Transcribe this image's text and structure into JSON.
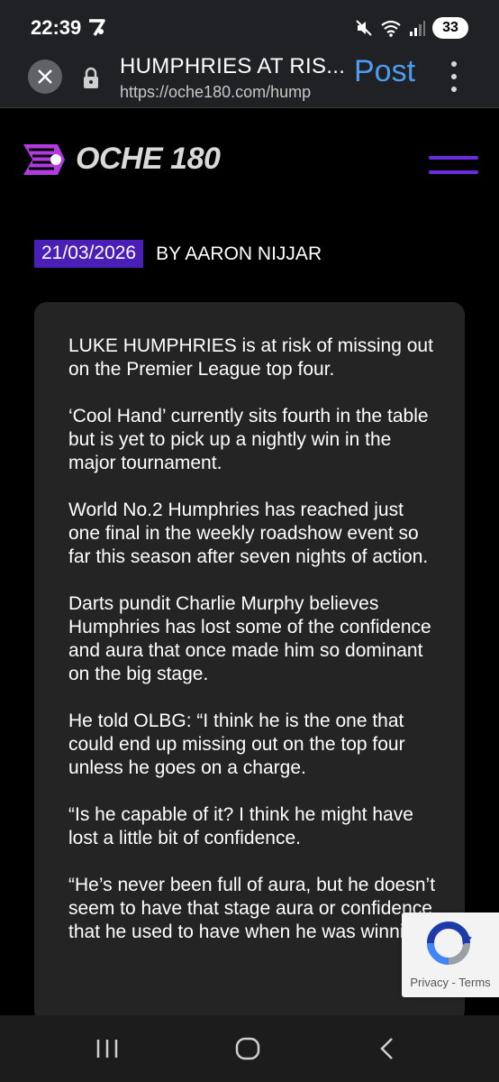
{
  "status": {
    "time": "22:39",
    "battery": "33"
  },
  "browser": {
    "page_title": "HUMPHRIES AT RIS...",
    "url": "https://oche180.com/hump",
    "post_label": "Post"
  },
  "site": {
    "logo_text": "OCHE 180",
    "accent_color": "#6b2ce0"
  },
  "article": {
    "date": "21/03/2026",
    "byline": "BY AARON NIJJAR",
    "paragraphs": [
      "LUKE HUMPHRIES is at risk of missing out on the Premier League top four.",
      "‘Cool Hand’ currently sits fourth in the table but is yet to pick up a nightly win in the major tournament.",
      "World No.2 Humphries has reached just one final in the weekly roadshow event so far this season after seven nights of action.",
      "Darts pundit Charlie Murphy believes Humphries has lost some of the confidence and aura that once made him so dominant on the big stage.",
      "He told OLBG: “I think he is the one that could end up missing out on the top four unless he goes on a charge.",
      "“Is he capable of it? I think he might have lost a little bit of confidence.",
      "“He’s never been full of aura, but he doesn’t seem to have that stage aura or confidence that he used to have when he was winning."
    ]
  },
  "recaptcha": {
    "links": "Privacy - Terms"
  }
}
